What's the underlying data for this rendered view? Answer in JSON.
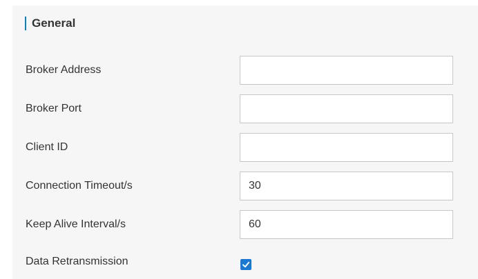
{
  "section": {
    "title": "General"
  },
  "fields": [
    {
      "label": "Broker Address",
      "value": ""
    },
    {
      "label": "Broker Port",
      "value": ""
    },
    {
      "label": "Client ID",
      "value": ""
    },
    {
      "label": "Connection Timeout/s",
      "value": "30"
    },
    {
      "label": "Keep Alive Interval/s",
      "value": "60"
    }
  ],
  "retransmission": {
    "label": "Data Retransmission",
    "checked": true,
    "icon": "checkmark-icon"
  },
  "colors": {
    "accent": "#0f7dc2",
    "checkbox": "#1a78d2",
    "panel_bg": "#f6f6f6"
  }
}
